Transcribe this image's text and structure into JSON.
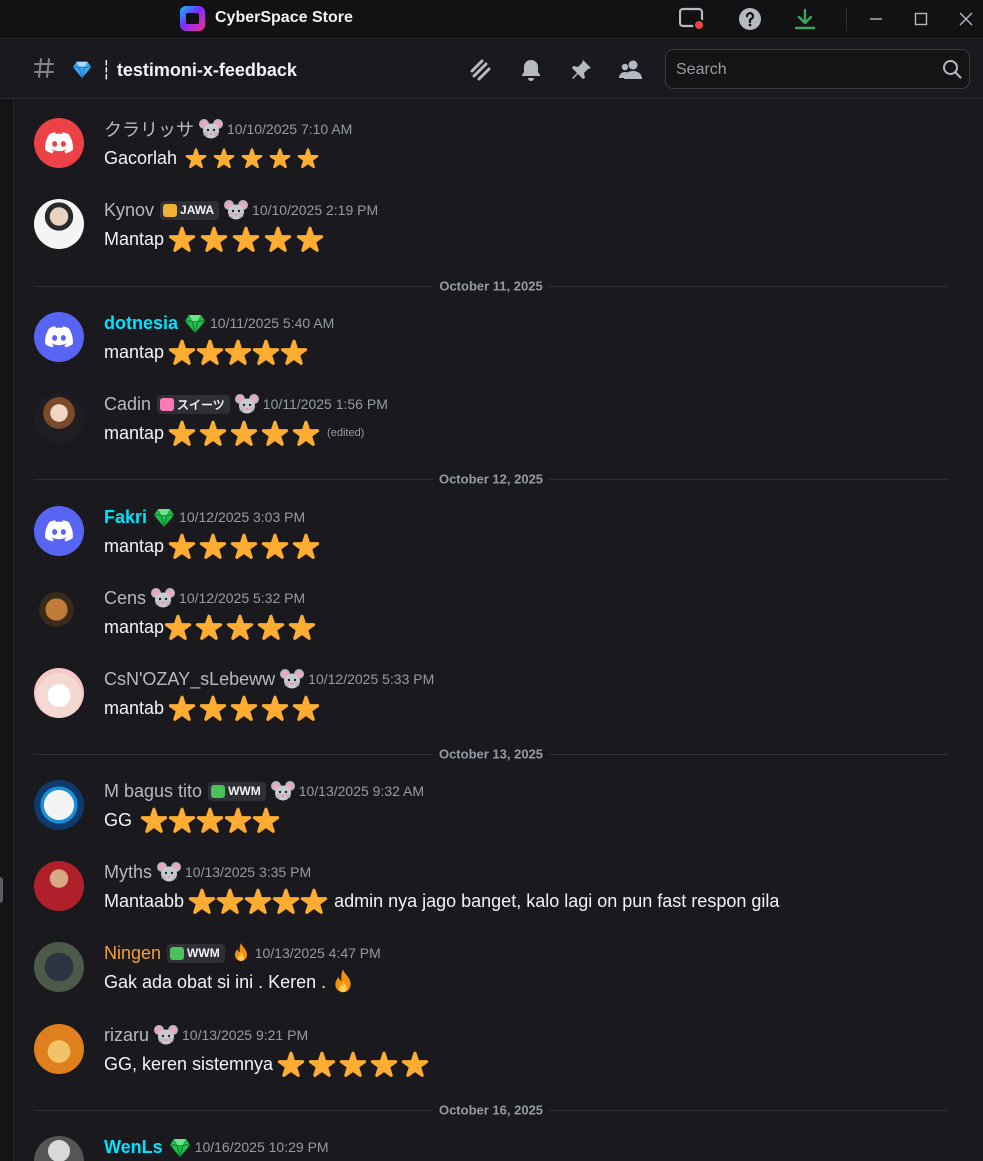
{
  "app": {
    "title": "CyberSpace Store"
  },
  "channel": {
    "name": "┆ testimoni-x-feedback",
    "emoji_icon": "gem-icon"
  },
  "search": {
    "placeholder": "Search"
  },
  "colors": {
    "background": "#1a1a1e",
    "titlebar": "#121214",
    "username_cyan": "#00e3ff",
    "username_orange": "#f0a33a",
    "star": "#ffac33",
    "discord_red": "#ed4245",
    "discord_blurple": "#5865f2"
  },
  "dividers": [
    {
      "label": "October 11, 2025"
    },
    {
      "label": "October 12, 2025"
    },
    {
      "label": "October 13, 2025"
    },
    {
      "label": "October 16, 2025"
    }
  ],
  "messages": [
    {
      "username": "クラリッサ",
      "timestamp": "10/10/2025 7:10 AM",
      "text": "Gacorlah",
      "stars": 5
    },
    {
      "username": "Kynov",
      "tag": "JAWA",
      "timestamp": "10/10/2025 2:19 PM",
      "text": "Mantap",
      "stars": 5
    },
    {
      "username": "dotnesia",
      "timestamp": "10/11/2025 5:40 AM",
      "text": "mantap",
      "stars": 5
    },
    {
      "username": "Cadin",
      "tag": "スイーツ",
      "timestamp": "10/11/2025 1:56 PM",
      "text": "mantap",
      "stars": 5,
      "edited": "(edited)"
    },
    {
      "username": "Fakri",
      "timestamp": "10/12/2025 3:03 PM",
      "text": "mantap",
      "stars": 5
    },
    {
      "username": "Cens",
      "timestamp": "10/12/2025 5:32 PM",
      "text": "mantap",
      "stars": 5
    },
    {
      "username": "CsN'OZAY_sLebeww",
      "timestamp": "10/12/2025 5:33 PM",
      "text": "mantab",
      "stars": 5
    },
    {
      "username": "M bagus tito",
      "tag": "WWM",
      "timestamp": "10/13/2025 9:32 AM",
      "text": "GG",
      "stars": 5
    },
    {
      "username": "Myths",
      "timestamp": "10/13/2025 3:35 PM",
      "text": "Mantaabb",
      "stars": 5,
      "text_after": "admin nya jago banget, kalo lagi on pun fast respon gila"
    },
    {
      "username": "Ningen",
      "tag": "WWM",
      "timestamp": "10/13/2025 4:47 PM",
      "text": "Gak ada obat si ini . Keren ."
    },
    {
      "username": "rizaru",
      "timestamp": "10/13/2025 9:21 PM",
      "text": "GG, keren sistemnya",
      "stars": 5
    },
    {
      "username": "WenLs",
      "timestamp": "10/16/2025 10:29 PM"
    }
  ]
}
